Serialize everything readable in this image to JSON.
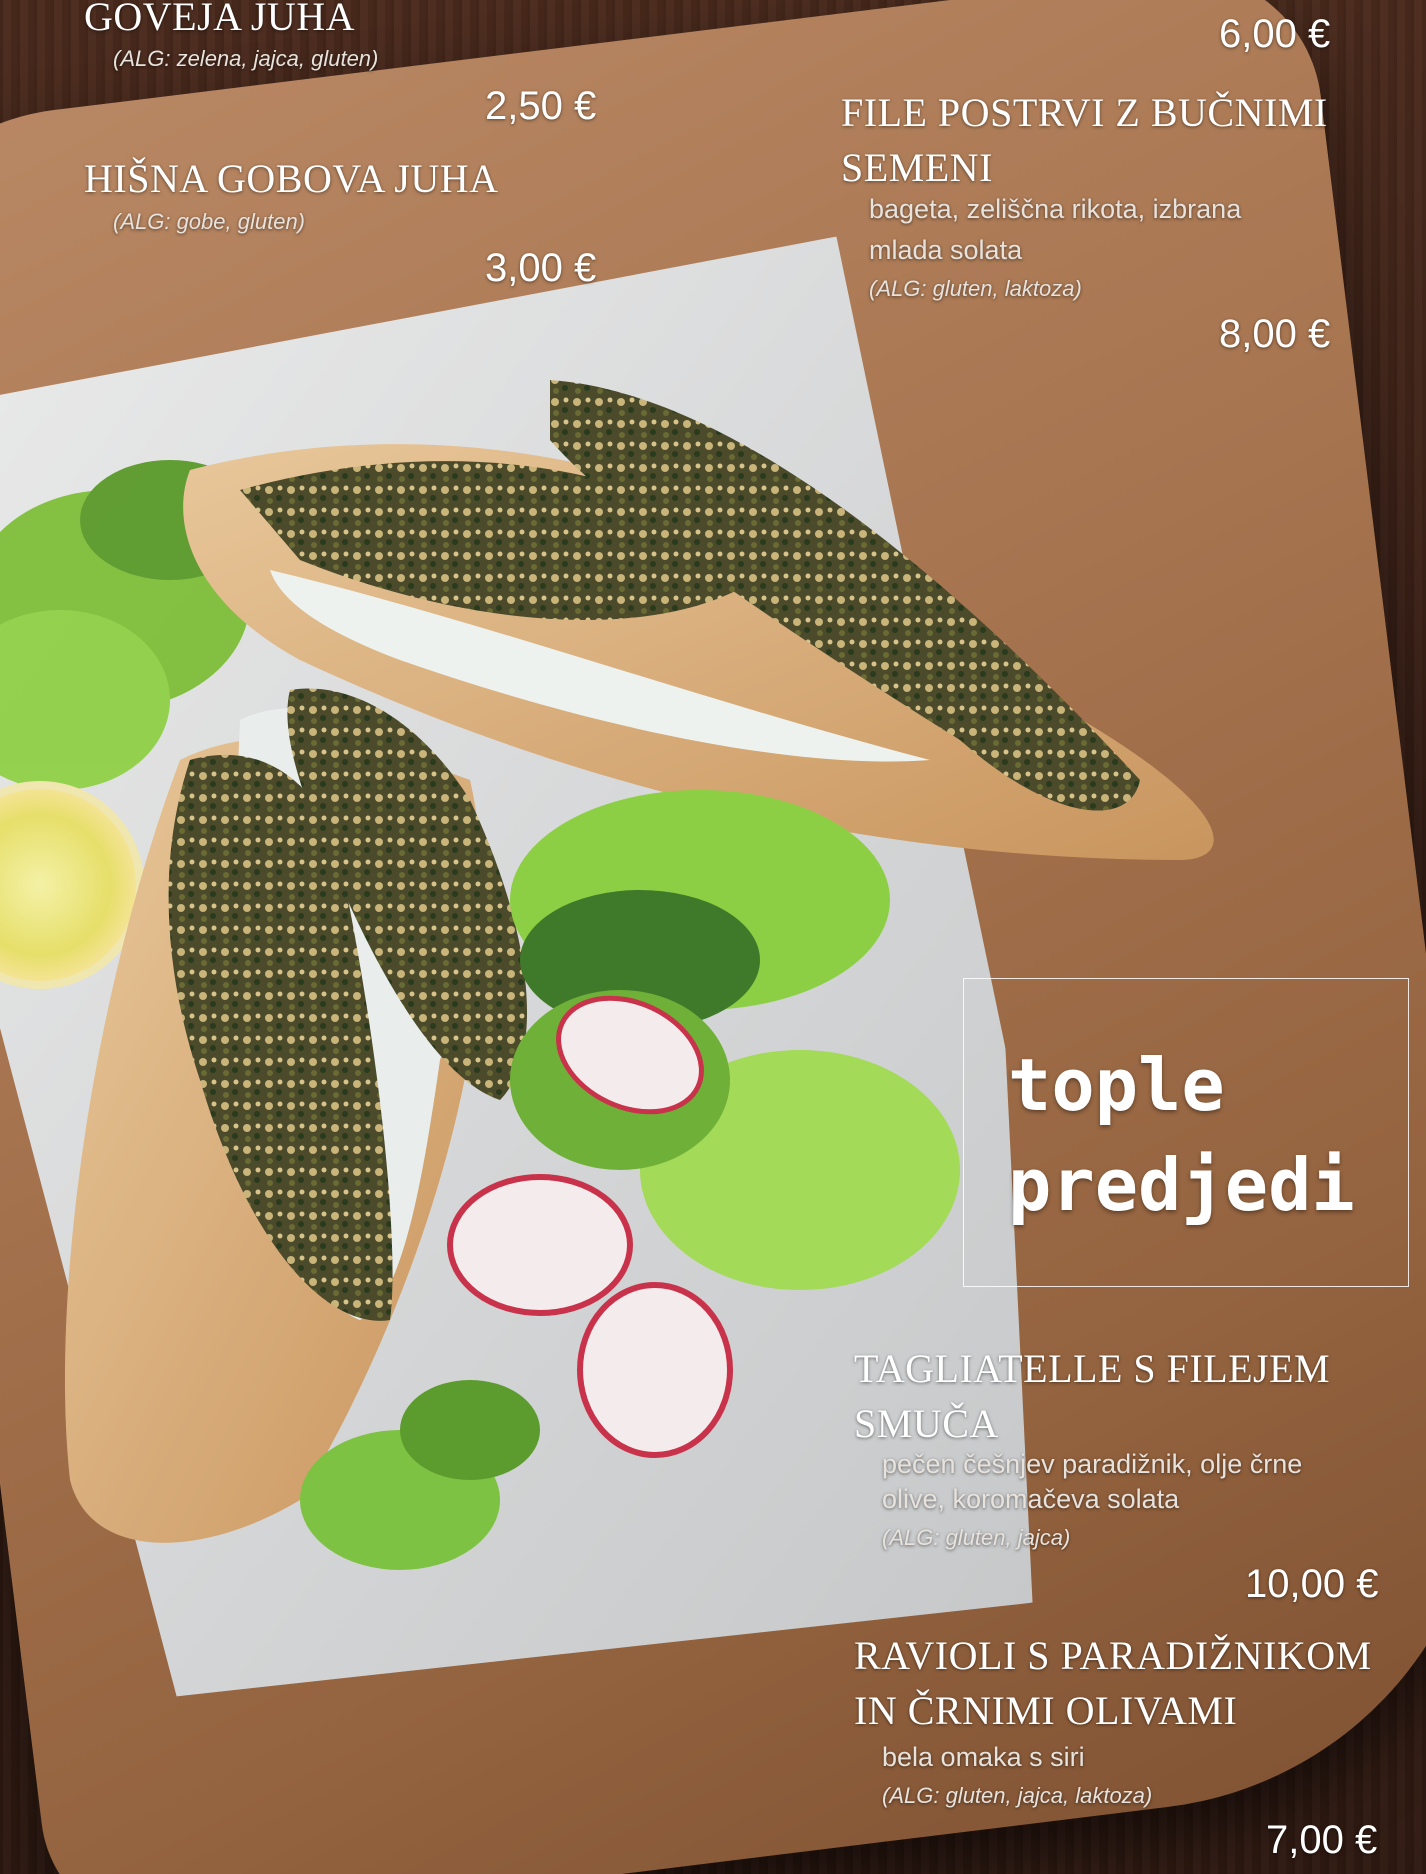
{
  "soups": [
    {
      "name": "GOVEJA JUHA",
      "allergens": "(ALG: zelena, jajca, gluten)",
      "price": "2,50 €"
    },
    {
      "name": "HIŠNA GOBOVA JUHA",
      "allergens": "(ALG: gobe, gluten)",
      "price": "3,00 €"
    }
  ],
  "cold": [
    {
      "price": "6,00 €"
    },
    {
      "name_line1": "FILE POSTRVI Z BUČNIMI",
      "name_line2": "SEMENI",
      "desc_line1": "bageta, zeliščna rikota, izbrana",
      "desc_line2": "mlada solata",
      "allergens": "(ALG: gluten, laktoza)",
      "price": "8,00 €"
    }
  ],
  "section": {
    "title_line1": "tople",
    "title_line2": "predjedi"
  },
  "warm": [
    {
      "name_line1": "TAGLIATELLE S FILEJEM",
      "name_line2": "SMUČA",
      "desc_line1": "pečen češnjev paradižnik, olje črne",
      "desc_line2": "olive, koromačeva solata",
      "allergens": "(ALG: gluten, jajca)",
      "price": "10,00 €"
    },
    {
      "name_line1": "RAVIOLI S PARADIŽNIKOM",
      "name_line2": "IN ČRNIMI OLIVAMI",
      "desc_line1": "bela omaka s siri",
      "allergens": "(ALG: gluten, jajca, laktoza)",
      "price": "7,00 €"
    }
  ]
}
